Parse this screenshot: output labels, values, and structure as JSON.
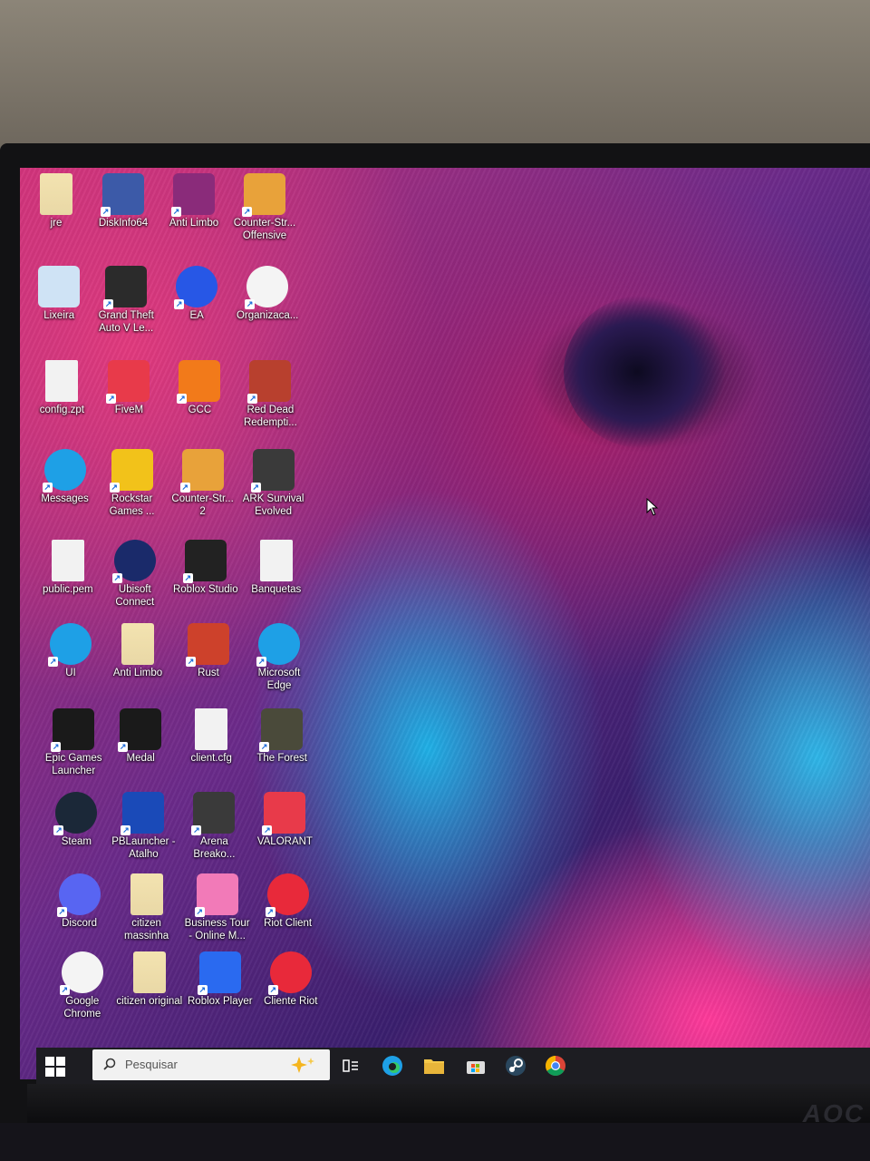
{
  "desktop": {
    "icons": [
      {
        "label": "jre",
        "icon": "folder-icon",
        "color": "#e9d8a6"
      },
      {
        "label": "DiskInfo64",
        "icon": "diskinfo-icon",
        "color": "#3c5aa8"
      },
      {
        "label": "Anti Limbo",
        "icon": "winrar-icon",
        "color": "#8a2b7a"
      },
      {
        "label": "Counter-Str... Offensive",
        "icon": "csgo-icon",
        "color": "#e8a23a"
      },
      {
        "label": "Lixeira",
        "icon": "recycle-bin-icon",
        "color": "#cfe3f5"
      },
      {
        "label": "Grand Theft Auto V Le...",
        "icon": "gta-v-icon",
        "color": "#2b2b2b"
      },
      {
        "label": "EA",
        "icon": "ea-icon",
        "color": "#2757e6"
      },
      {
        "label": "Organizaca...",
        "icon": "chrome-icon",
        "color": "#f4f4f4"
      },
      {
        "label": "config.zpt",
        "icon": "file-icon",
        "color": "#f2f2f2"
      },
      {
        "label": "FiveM",
        "icon": "fivem-icon",
        "color": "#e83a4a"
      },
      {
        "label": "GCC",
        "icon": "gcc-icon",
        "color": "#f27a1a"
      },
      {
        "label": "Red Dead Redempti...",
        "icon": "rdr-icon",
        "color": "#b8402e"
      },
      {
        "label": "Messages",
        "icon": "edge-icon",
        "color": "#1ea0e6"
      },
      {
        "label": "Rockstar Games ...",
        "icon": "rockstar-icon",
        "color": "#f2c21a"
      },
      {
        "label": "Counter-Str... 2",
        "icon": "cs2-icon",
        "color": "#e8a23a"
      },
      {
        "label": "ARK Survival Evolved",
        "icon": "ark-icon",
        "color": "#3a3a3a"
      },
      {
        "label": "public.pem",
        "icon": "file-icon",
        "color": "#f2f2f2"
      },
      {
        "label": "Ubisoft Connect",
        "icon": "ubisoft-icon",
        "color": "#1a2a6a"
      },
      {
        "label": "Roblox Studio",
        "icon": "roblox-studio-icon",
        "color": "#222222"
      },
      {
        "label": "Banquetas",
        "icon": "file-icon",
        "color": "#f2f2f2"
      },
      {
        "label": "UI",
        "icon": "edge-icon",
        "color": "#1ea0e6"
      },
      {
        "label": "Anti Limbo",
        "icon": "folder-icon",
        "color": "#e9d8a6"
      },
      {
        "label": "Rust",
        "icon": "rust-icon",
        "color": "#cd412b"
      },
      {
        "label": "Microsoft Edge",
        "icon": "edge-icon",
        "color": "#1ea0e6"
      },
      {
        "label": "Epic Games Launcher",
        "icon": "epic-games-icon",
        "color": "#1a1a1a"
      },
      {
        "label": "Medal",
        "icon": "medal-icon",
        "color": "#1a1a1a"
      },
      {
        "label": "client.cfg",
        "icon": "file-icon",
        "color": "#f2f2f2"
      },
      {
        "label": "The Forest",
        "icon": "the-forest-icon",
        "color": "#4a4a3a"
      },
      {
        "label": "Steam",
        "icon": "steam-icon",
        "color": "#1b2838"
      },
      {
        "label": "PBLauncher - Atalho",
        "icon": "pblauncher-icon",
        "color": "#1a4ab8"
      },
      {
        "label": "Arena Breako...",
        "icon": "arena-breakout-icon",
        "color": "#3a3a3a"
      },
      {
        "label": "VALORANT",
        "icon": "valorant-icon",
        "color": "#e83a4a"
      },
      {
        "label": "Discord",
        "icon": "discord-icon",
        "color": "#5865f2"
      },
      {
        "label": "citizen massinha",
        "icon": "folder-icon",
        "color": "#e9d8a6"
      },
      {
        "label": "Business Tour - Online M...",
        "icon": "business-tour-icon",
        "color": "#f27ab8"
      },
      {
        "label": "Riot Client",
        "icon": "riot-client-icon",
        "color": "#e8293a"
      },
      {
        "label": "Google Chrome",
        "icon": "chrome-icon",
        "color": "#f4f4f4"
      },
      {
        "label": "citizen original",
        "icon": "folder-icon",
        "color": "#e9d8a6"
      },
      {
        "label": "Roblox Player",
        "icon": "roblox-player-icon",
        "color": "#2a6af0"
      },
      {
        "label": "Cliente Riot",
        "icon": "riot-client-icon",
        "color": "#e8293a"
      }
    ]
  },
  "taskbar": {
    "search_placeholder": "Pesquisar",
    "pinned": [
      "task-view-icon",
      "edge-icon",
      "file-explorer-icon",
      "store-icon",
      "steam-icon",
      "chrome-icon"
    ]
  },
  "monitor": {
    "brand": "AOC"
  }
}
